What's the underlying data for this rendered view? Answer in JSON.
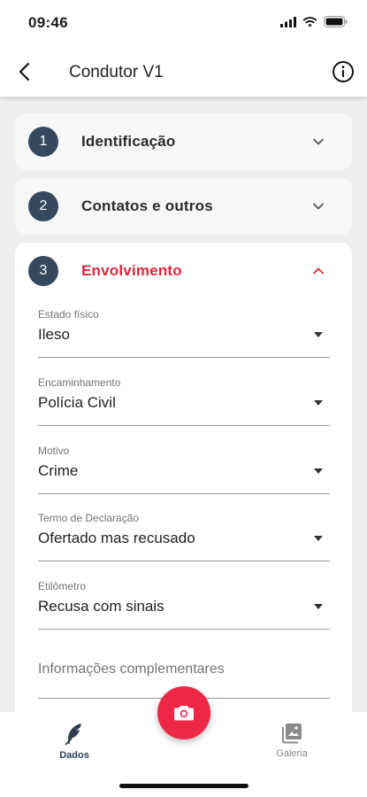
{
  "status_bar": {
    "time": "09:46"
  },
  "header": {
    "title": "Condutor V1"
  },
  "steps": [
    {
      "number": "1",
      "label": "Identificação",
      "expanded": false
    },
    {
      "number": "2",
      "label": "Contatos e outros",
      "expanded": false
    },
    {
      "number": "3",
      "label": "Envolvimento",
      "expanded": true
    }
  ],
  "form": {
    "estado_fisico": {
      "label": "Estado físico",
      "value": "Ileso"
    },
    "encaminhamento": {
      "label": "Encaminhamento",
      "value": "Polícia Civil"
    },
    "motivo": {
      "label": "Motivo",
      "value": "Crime"
    },
    "termo": {
      "label": "Termo de Declaração",
      "value": "Ofertado mas recusado"
    },
    "etilometro": {
      "label": "Etilômetro",
      "value": "Recusa com sinais"
    },
    "informacoes": {
      "placeholder": "Informações complementares"
    }
  },
  "bottom_nav": {
    "dados": {
      "label": "Dados",
      "icon": "feather-icon",
      "active": true
    },
    "galeria": {
      "label": "Galeria",
      "icon": "gallery-icon",
      "active": false
    }
  },
  "fab": {
    "icon": "camera-icon"
  },
  "colors": {
    "accent": "#ec2846",
    "step_circle": "#34495e",
    "active_step_text": "#e0263a",
    "background": "#efefef"
  }
}
